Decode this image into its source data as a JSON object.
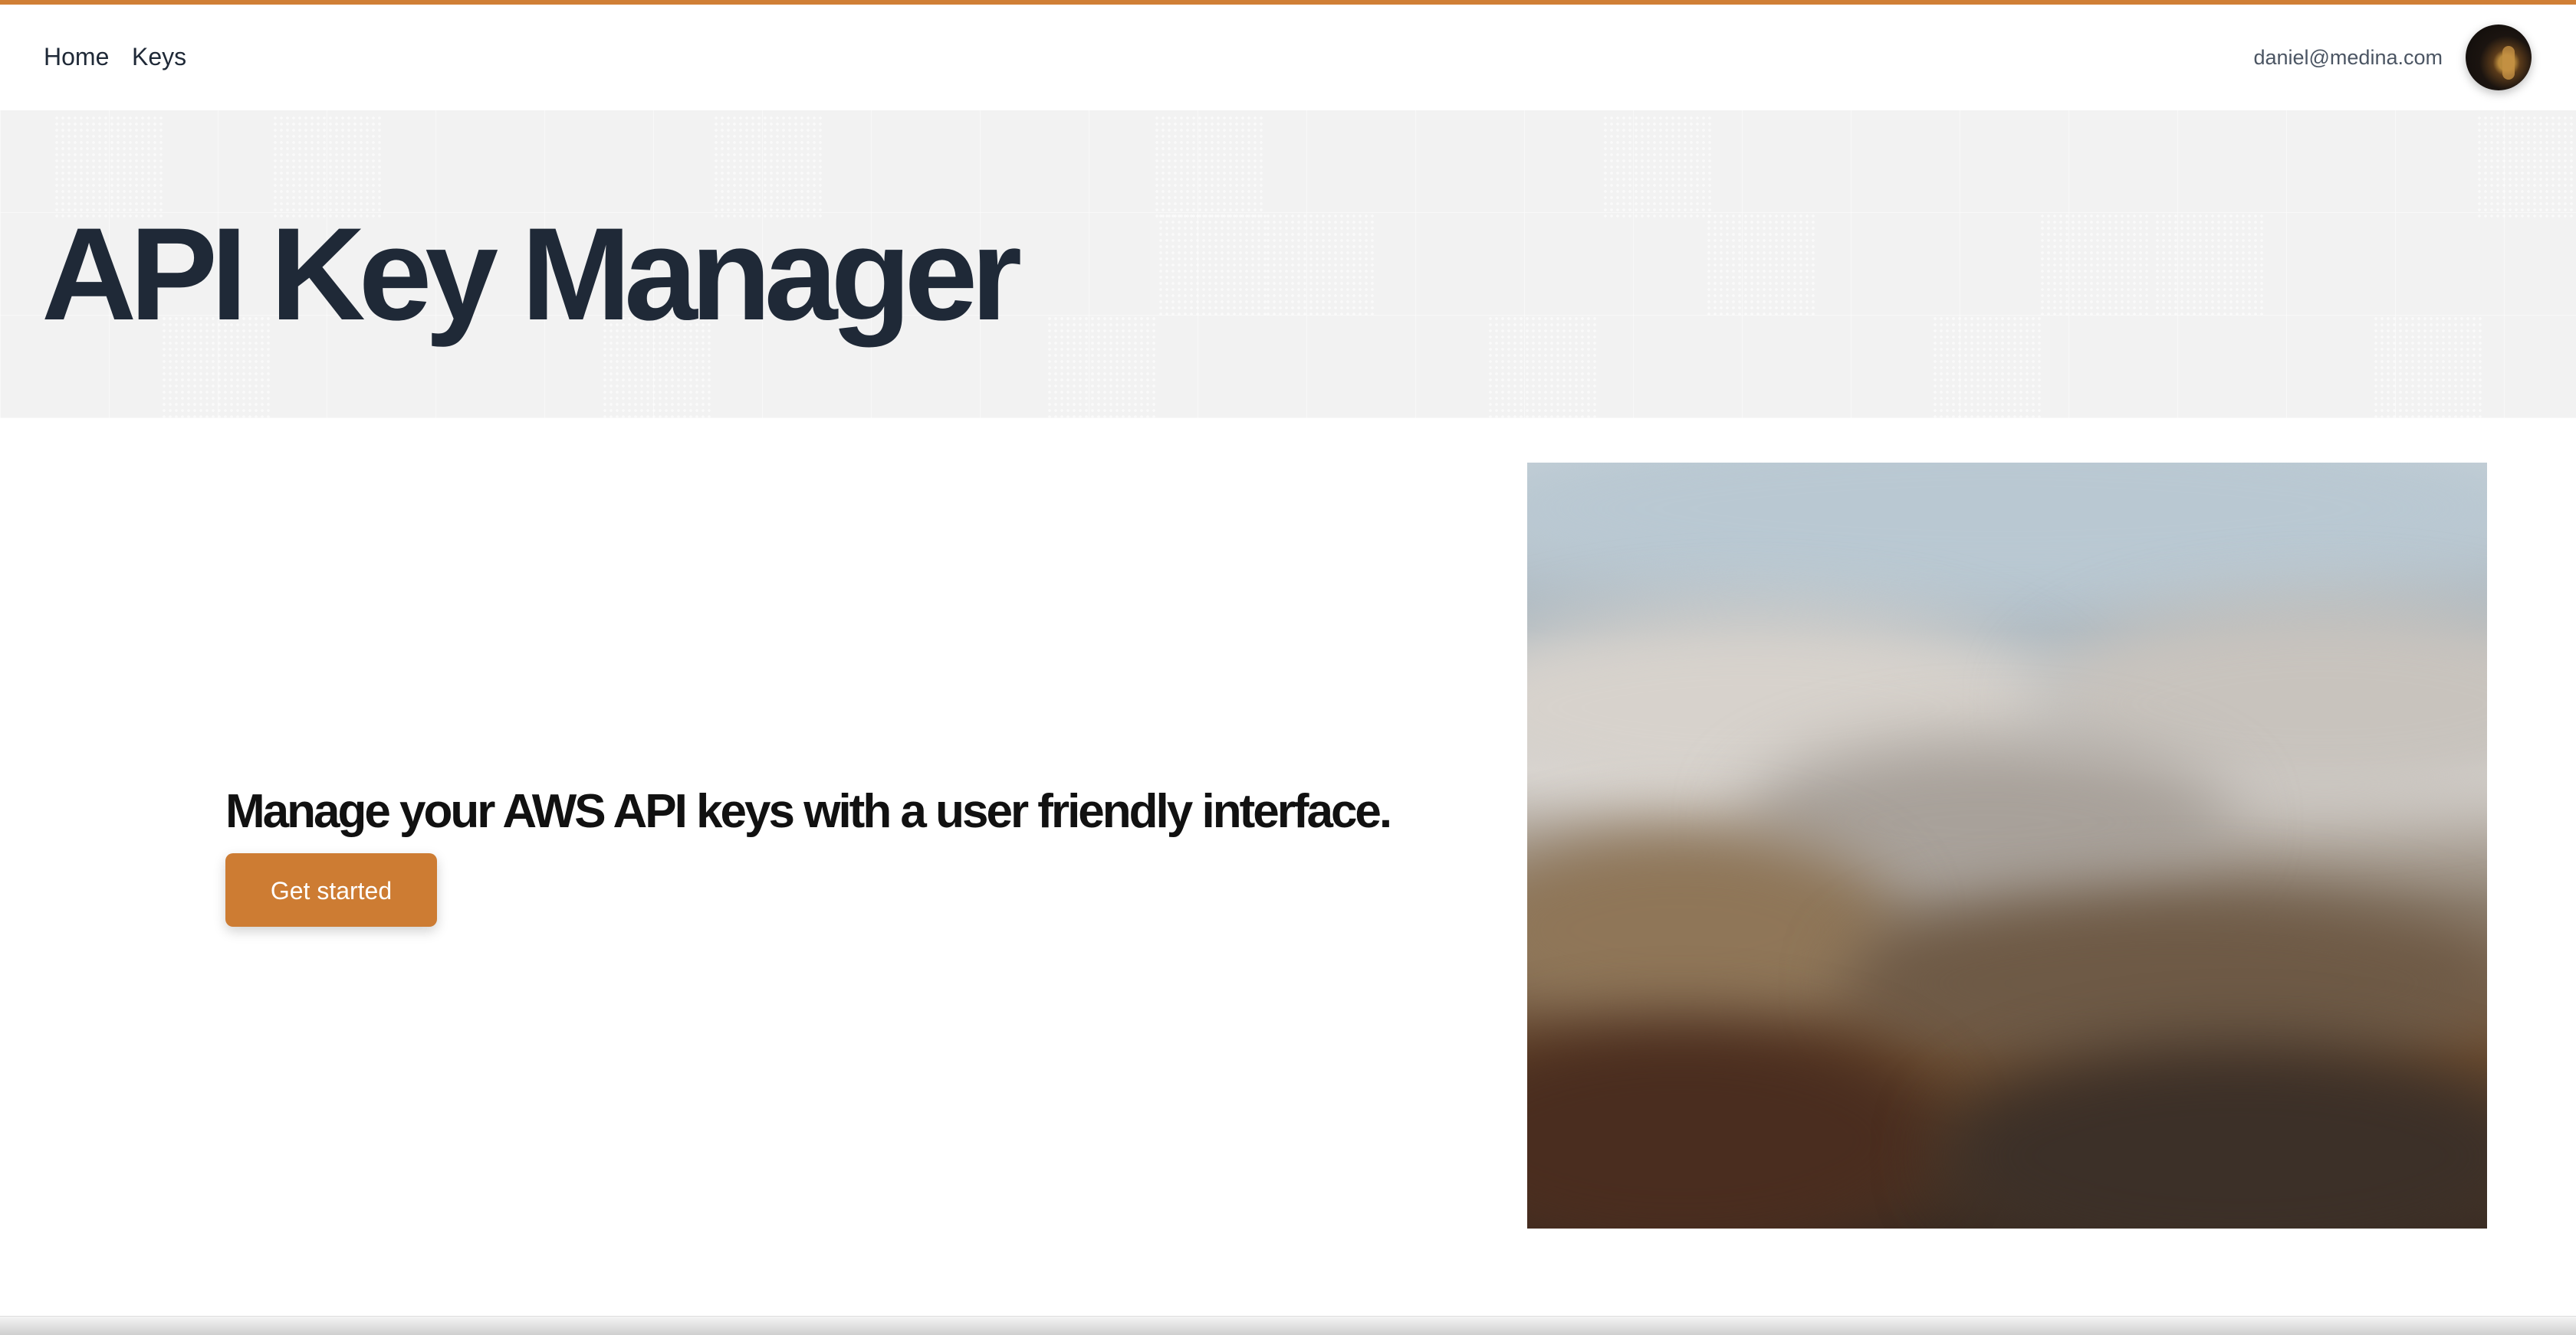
{
  "nav": {
    "links": [
      {
        "label": "Home"
      },
      {
        "label": "Keys"
      }
    ],
    "user_email": "daniel@medina.com"
  },
  "hero": {
    "title": "API Key Manager",
    "tagline": "Manage your AWS API keys with a user friendly interface.",
    "cta_label": "Get started"
  },
  "colors": {
    "accent": "#d07f36",
    "button": "#cd7c33",
    "title_text": "#1f2937",
    "hero_background": "#f2f2f2"
  },
  "icons": {
    "avatar": "user-avatar-photo"
  }
}
